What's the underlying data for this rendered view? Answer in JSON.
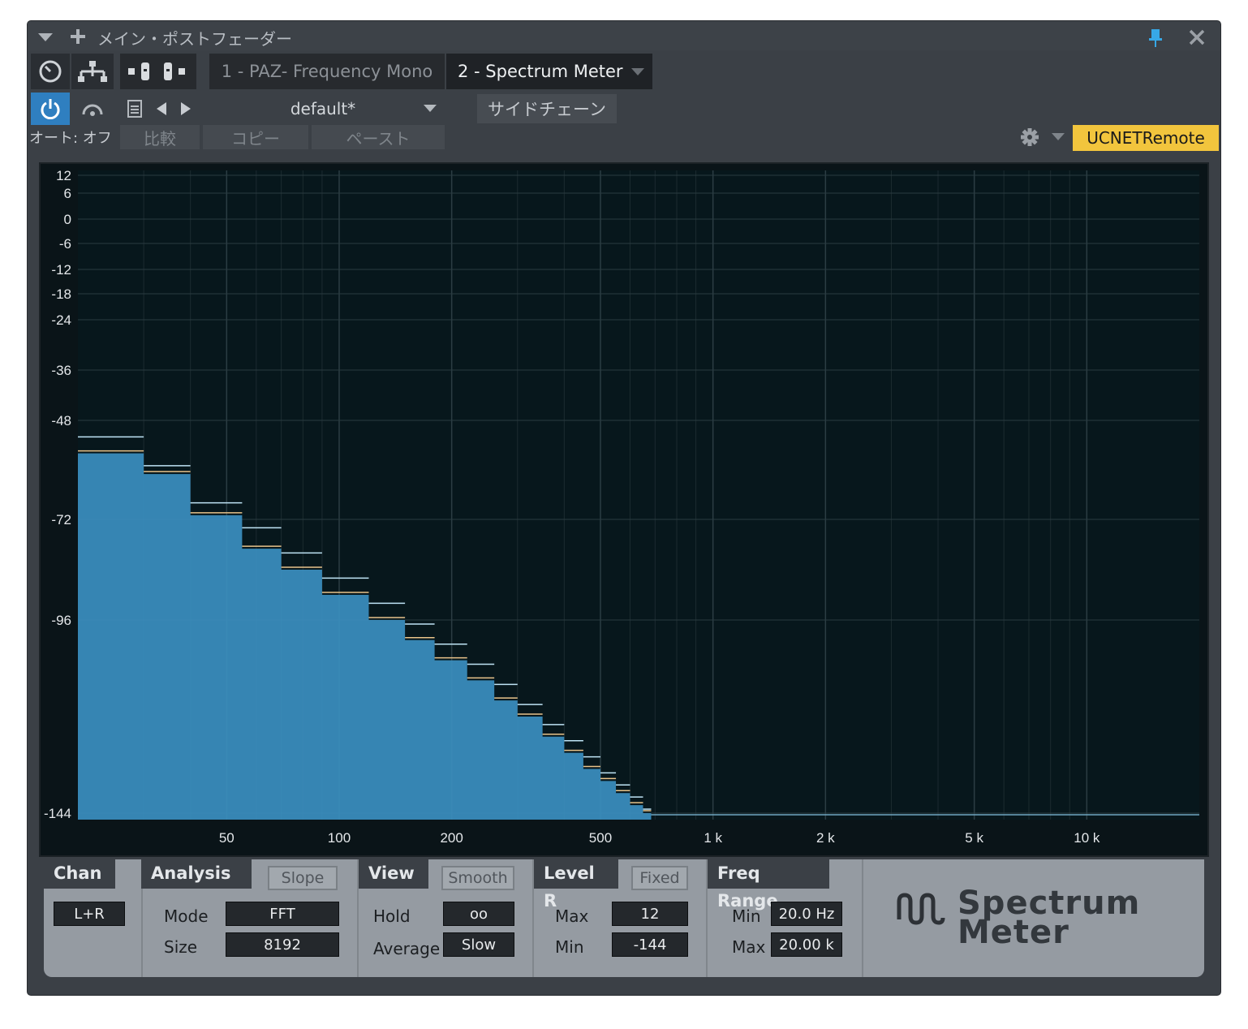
{
  "window": {
    "title": "メイン・ポストフェーダー"
  },
  "plugin_tabs": [
    {
      "label": "1 - PAZ- Frequency Mono",
      "active": false
    },
    {
      "label": "2 - Spectrum Meter",
      "active": true
    }
  ],
  "preset": {
    "name": "default*",
    "sidechain_label": "サイドチェーン"
  },
  "automation": {
    "auto_label": "オート: オフ",
    "compare_label": "比較",
    "copy_label": "コピー",
    "paste_label": "ペースト"
  },
  "remote_badge": {
    "label": "UCNETRemote",
    "color": "#f2c53d"
  },
  "icons": [
    "chevron-down-icon",
    "plus-icon",
    "pin-icon",
    "close-icon",
    "clock-icon",
    "routing-icon",
    "plugin-left-icon",
    "plugin-right-icon",
    "power-icon",
    "monitor-icon",
    "preset-list-icon",
    "prev-arrow-icon",
    "next-arrow-icon",
    "gear-icon"
  ],
  "chart_data": {
    "type": "area",
    "x_scale": "log",
    "xlim": [
      20,
      20000
    ],
    "ylim": [
      -144,
      12
    ],
    "x_tick_labels": [
      {
        "label": "50",
        "value": 50
      },
      {
        "label": "100",
        "value": 100
      },
      {
        "label": "200",
        "value": 200
      },
      {
        "label": "500",
        "value": 500
      },
      {
        "label": "1 k",
        "value": 1000
      },
      {
        "label": "2 k",
        "value": 2000
      },
      {
        "label": "5 k",
        "value": 5000
      },
      {
        "label": "10 k",
        "value": 10000
      }
    ],
    "y_tick_labels": [
      {
        "label": "12",
        "value": 12
      },
      {
        "label": "6",
        "value": 6
      },
      {
        "label": "0",
        "value": 0
      },
      {
        "label": "-6",
        "value": -6
      },
      {
        "label": "-12",
        "value": -12
      },
      {
        "label": "-18",
        "value": -18
      },
      {
        "label": "-24",
        "value": -24
      },
      {
        "label": "-36",
        "value": -36
      },
      {
        "label": "-48",
        "value": -48
      },
      {
        "label": "-72",
        "value": -72
      },
      {
        "label": "-96",
        "value": -96
      },
      {
        "label": "-144",
        "value": -144
      }
    ],
    "grid": true,
    "fill_color": "#3b8fc0",
    "hold_color": "#bfe4f5",
    "avg_color": "#e9c48b",
    "spectrum": {
      "x": [
        20,
        30,
        40,
        55,
        70,
        90,
        120,
        150,
        180,
        220,
        260,
        300,
        350,
        400,
        450,
        500,
        550,
        600,
        650
      ],
      "level": [
        -56,
        -61,
        -71,
        -79,
        -84,
        -90,
        -96,
        -101,
        -106,
        -111,
        -116,
        -120,
        -125,
        -129,
        -133,
        -136,
        -139,
        -142,
        -144
      ],
      "hold": [
        -52,
        -59,
        -68,
        -74,
        -80,
        -86,
        -92,
        -97,
        -102,
        -107,
        -112,
        -117,
        -122,
        -126,
        -130,
        -134,
        -137,
        -140,
        -143
      ]
    }
  },
  "controls": {
    "chan": {
      "title": "Chan",
      "value": "L+R"
    },
    "analysis": {
      "title": "Analysis",
      "slope_label": "Slope",
      "mode_label": "Mode",
      "mode_value": "FFT",
      "size_label": "Size",
      "size_value": "8192"
    },
    "view": {
      "title": "View",
      "smooth_label": "Smooth",
      "hold_label": "Hold",
      "hold_value": "oo",
      "average_label": "Average",
      "average_value": "Slow"
    },
    "level": {
      "title": "Level R",
      "fixed_label": "Fixed",
      "max_label": "Max",
      "max_value": "12",
      "min_label": "Min",
      "min_value": "-144"
    },
    "freq_range": {
      "title": "Freq Range",
      "min_label": "Min",
      "min_value": "20.0 Hz",
      "max_label": "Max",
      "max_value": "20.00 k"
    }
  },
  "logo": {
    "line1": "Spectrum",
    "line2": "Meter"
  }
}
